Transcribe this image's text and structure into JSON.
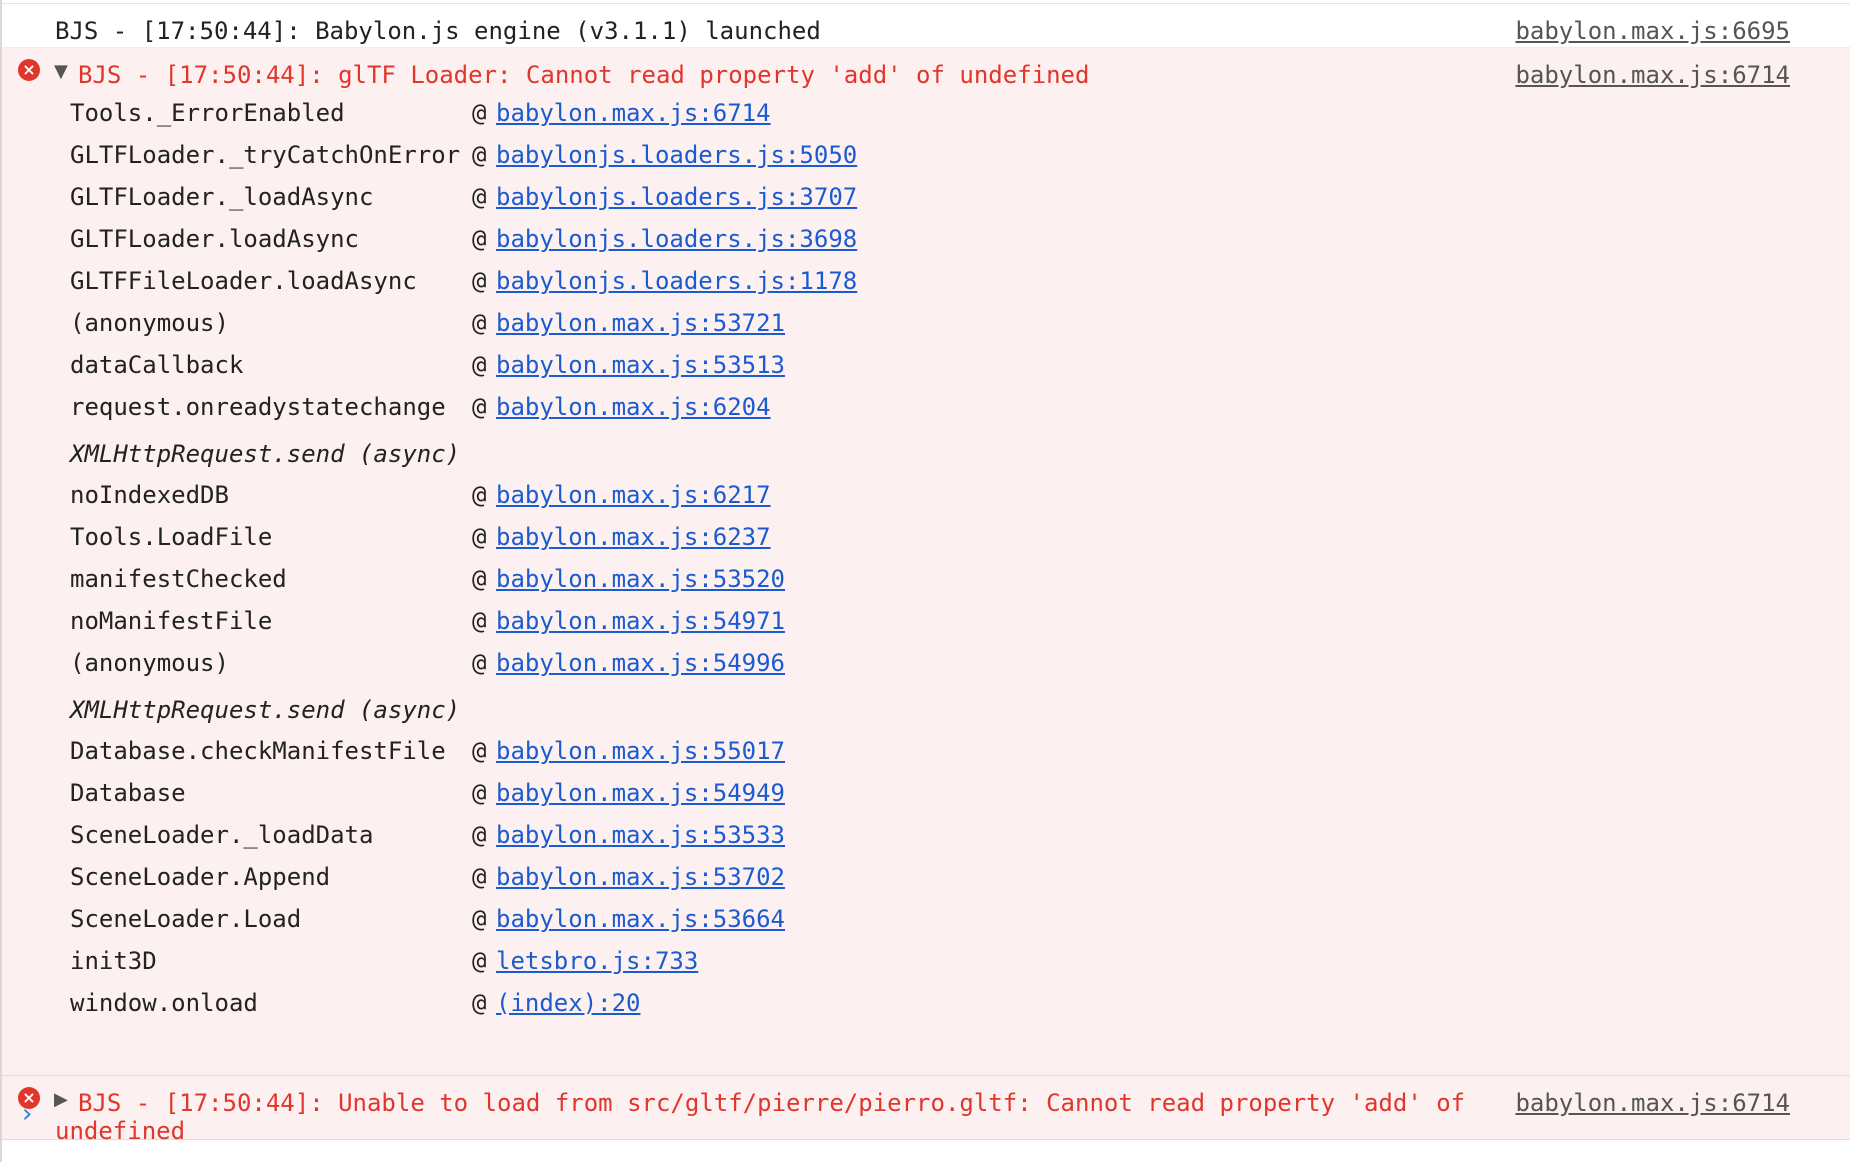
{
  "colors": {
    "error_text": "#e0362b",
    "error_bg": "#fdf0f0",
    "link": "#1a5bd1",
    "prompt": "#2f7ae5"
  },
  "log1": {
    "text": "BJS - [17:50:44]: Babylon.js engine (v3.1.1) launched",
    "source": "babylon.max.js:6695"
  },
  "error1": {
    "icon": "×",
    "toggle": "▼",
    "text": "BJS - [17:50:44]: glTF Loader: Cannot read property 'add' of undefined",
    "source": "babylon.max.js:6714",
    "stack": [
      {
        "fn": "Tools._ErrorEnabled",
        "at": "@",
        "link": "babylon.max.js:6714"
      },
      {
        "fn": "GLTFLoader._tryCatchOnError",
        "at": "@",
        "link": "babylonjs.loaders.js:5050"
      },
      {
        "fn": "GLTFLoader._loadAsync",
        "at": "@",
        "link": "babylonjs.loaders.js:3707"
      },
      {
        "fn": "GLTFLoader.loadAsync",
        "at": "@",
        "link": "babylonjs.loaders.js:3698"
      },
      {
        "fn": "GLTFFileLoader.loadAsync",
        "at": "@",
        "link": "babylonjs.loaders.js:1178"
      },
      {
        "fn": "(anonymous)",
        "at": "@",
        "link": "babylon.max.js:53721"
      },
      {
        "fn": "dataCallback",
        "at": "@",
        "link": "babylon.max.js:53513"
      },
      {
        "fn": "request.onreadystatechange",
        "at": "@",
        "link": "babylon.max.js:6204"
      },
      {
        "fn": "XMLHttpRequest.send (async)",
        "async": true
      },
      {
        "fn": "noIndexedDB",
        "at": "@",
        "link": "babylon.max.js:6217"
      },
      {
        "fn": "Tools.LoadFile",
        "at": "@",
        "link": "babylon.max.js:6237"
      },
      {
        "fn": "manifestChecked",
        "at": "@",
        "link": "babylon.max.js:53520"
      },
      {
        "fn": "noManifestFile",
        "at": "@",
        "link": "babylon.max.js:54971"
      },
      {
        "fn": "(anonymous)",
        "at": "@",
        "link": "babylon.max.js:54996"
      },
      {
        "fn": "XMLHttpRequest.send (async)",
        "async": true
      },
      {
        "fn": "Database.checkManifestFile",
        "at": "@",
        "link": "babylon.max.js:55017"
      },
      {
        "fn": "Database",
        "at": "@",
        "link": "babylon.max.js:54949"
      },
      {
        "fn": "SceneLoader._loadData",
        "at": "@",
        "link": "babylon.max.js:53533"
      },
      {
        "fn": "SceneLoader.Append",
        "at": "@",
        "link": "babylon.max.js:53702"
      },
      {
        "fn": "SceneLoader.Load",
        "at": "@",
        "link": "babylon.max.js:53664"
      },
      {
        "fn": "init3D",
        "at": "@",
        "link": "letsbro.js:733"
      },
      {
        "fn": "window.onload",
        "at": "@",
        "link": "(index):20"
      }
    ]
  },
  "error2": {
    "icon": "×",
    "toggle": "▶",
    "text_line1": "BJS - [17:50:44]: Unable to load from src/gltf/pierre/pierro.gltf: Cannot read property 'add' of",
    "text_line2": "undefined",
    "source": "babylon.max.js:6714"
  },
  "prompt": {
    "symbol": "›"
  }
}
